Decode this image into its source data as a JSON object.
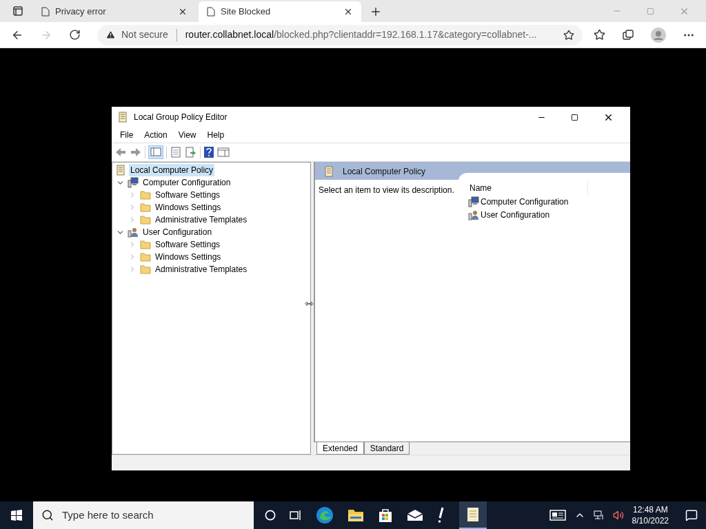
{
  "browser": {
    "tabs": [
      {
        "title": "Privacy error",
        "selected": false
      },
      {
        "title": "Site Blocked",
        "selected": true
      }
    ],
    "security": "Not secure",
    "url_host": "router.collabnet.local",
    "url_rest": "/blocked.php?clientaddr=192.168.1.17&category=collabnet-..."
  },
  "dialog": {
    "title": "Local Group Policy Editor",
    "menu": [
      "File",
      "Action",
      "View",
      "Help"
    ],
    "tree": [
      {
        "label": "Local Computer Policy",
        "kind": "policy",
        "selected": true,
        "children": [
          {
            "label": "Computer Configuration",
            "kind": "computer",
            "selected": false,
            "expanded": true,
            "children": [
              {
                "label": "Software Settings",
                "kind": "folder",
                "selected": false,
                "expanded": false
              },
              {
                "label": "Windows Settings",
                "kind": "folder",
                "selected": false,
                "expanded": false
              },
              {
                "label": "Administrative Templates",
                "kind": "folder",
                "selected": false,
                "expanded": false
              }
            ]
          },
          {
            "label": "User Configuration",
            "kind": "user",
            "selected": false,
            "expanded": true,
            "children": [
              {
                "label": "Software Settings",
                "kind": "folder",
                "selected": false,
                "expanded": false
              },
              {
                "label": "Windows Settings",
                "kind": "folder",
                "selected": false,
                "expanded": false
              },
              {
                "label": "Administrative Templates",
                "kind": "folder",
                "selected": false,
                "expanded": false
              }
            ]
          }
        ]
      }
    ],
    "details": {
      "header": "Local Computer Policy",
      "description": "Select an item to view its description.",
      "column": "Name",
      "items": [
        {
          "label": "Computer Configuration",
          "kind": "computer"
        },
        {
          "label": "User Configuration",
          "kind": "user"
        }
      ]
    },
    "view_tabs": [
      {
        "label": "Extended",
        "selected": true
      },
      {
        "label": "Standard",
        "selected": false
      }
    ]
  },
  "taskbar": {
    "search_placeholder": "Type here to search",
    "time": "12:48 AM",
    "date": "8/10/2022"
  }
}
